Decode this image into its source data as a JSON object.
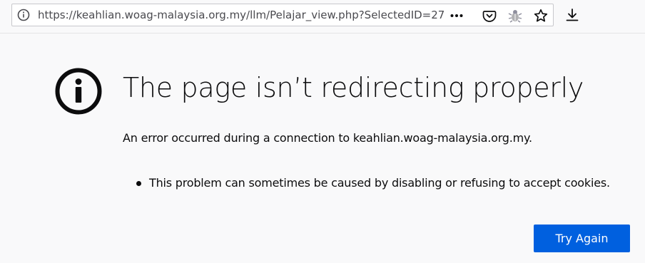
{
  "browser": {
    "url": "https://keahlian.woag-malaysia.org.my/llm/Pelajar_view.php?SelectedID=27",
    "icons": {
      "site_info": "info-icon",
      "page_actions": "more-horizontal-icon",
      "pocket": "pocket-icon",
      "extension": "extension-bug-icon",
      "bookmark": "star-icon",
      "download": "download-icon"
    }
  },
  "error_page": {
    "icon": "info-circle-icon",
    "title": "The page isn’t redirecting properly",
    "description": "An error occurred during a connection to keahlian.woag-malaysia.org.my.",
    "bullets": [
      "This problem can sometimes be caused by disabling or refusing to accept cookies."
    ],
    "try_again_label": "Try Again",
    "accent_color": "#0060df"
  }
}
